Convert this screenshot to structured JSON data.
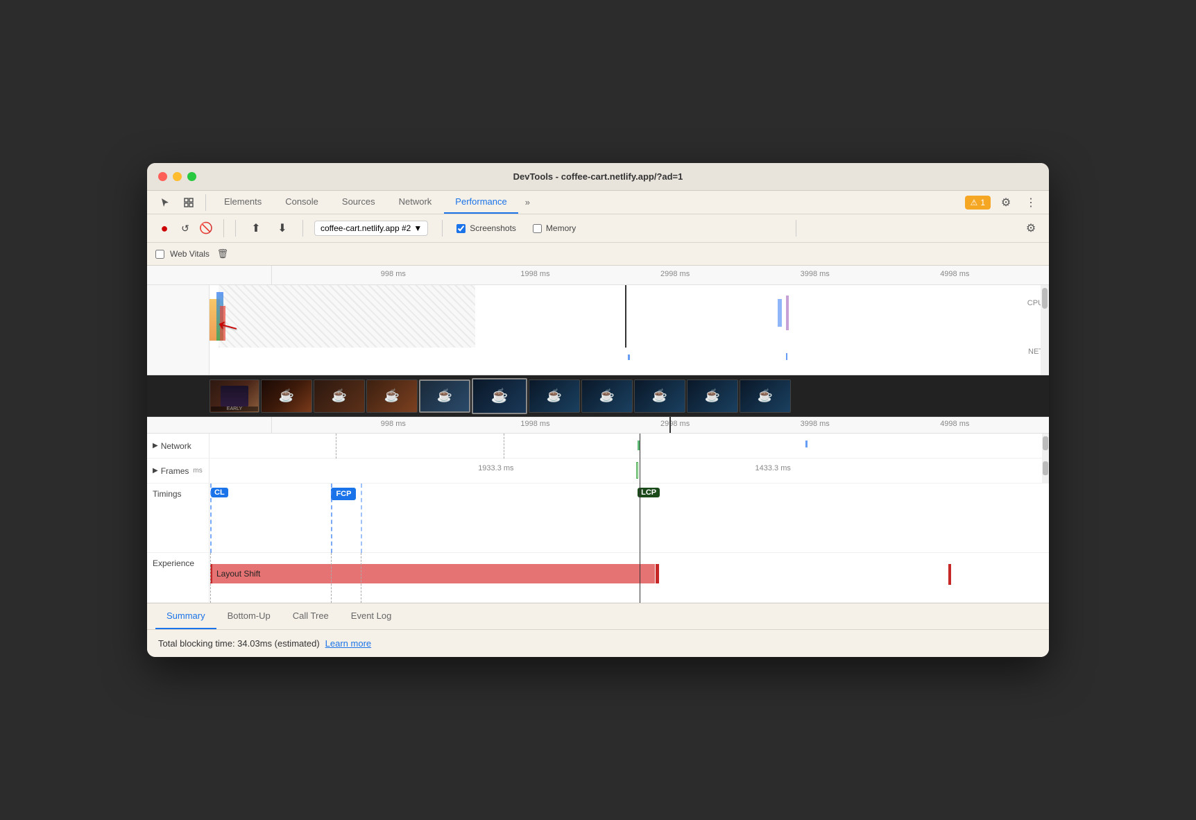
{
  "window": {
    "title": "DevTools - coffee-cart.netlify.app/?ad=1"
  },
  "tabs": {
    "items": [
      {
        "label": "Elements",
        "active": false
      },
      {
        "label": "Console",
        "active": false
      },
      {
        "label": "Sources",
        "active": false
      },
      {
        "label": "Network",
        "active": false
      },
      {
        "label": "Performance",
        "active": true
      },
      {
        "label": "»",
        "active": false
      }
    ],
    "more": "»"
  },
  "toolbar": {
    "profile_select": "coffee-cart.netlify.app #2",
    "screenshots_label": "Screenshots",
    "memory_label": "Memory",
    "webvitals_label": "Web Vitals"
  },
  "ruler": {
    "marks": [
      "998 ms",
      "1998 ms",
      "2998 ms",
      "3998 ms",
      "4998 ms"
    ],
    "labels_right": [
      "CPU",
      "NET"
    ]
  },
  "tracks": {
    "network_label": "Network",
    "frames_label": "Frames",
    "frames_timing1": "ms",
    "frames_timing2": "1933.3 ms",
    "frames_timing3": "1433.3 ms",
    "timings_label": "Timings",
    "timing_cl": "CL",
    "timing_fcp": "FCP",
    "timing_lcp": "LCP",
    "experience_label": "Experience",
    "layout_shift_label": "Layout Shift"
  },
  "bottom_tabs": [
    {
      "label": "Summary",
      "active": true
    },
    {
      "label": "Bottom-Up",
      "active": false
    },
    {
      "label": "Call Tree",
      "active": false
    },
    {
      "label": "Event Log",
      "active": false
    }
  ],
  "status": {
    "text": "Total blocking time: 34.03ms (estimated)",
    "learn_more": "Learn more"
  },
  "badge": {
    "count": "1",
    "icon": "⚠"
  },
  "colors": {
    "accent": "#1a73e8",
    "record": "#cc0000",
    "active_tab_underline": "#1a73e8"
  }
}
